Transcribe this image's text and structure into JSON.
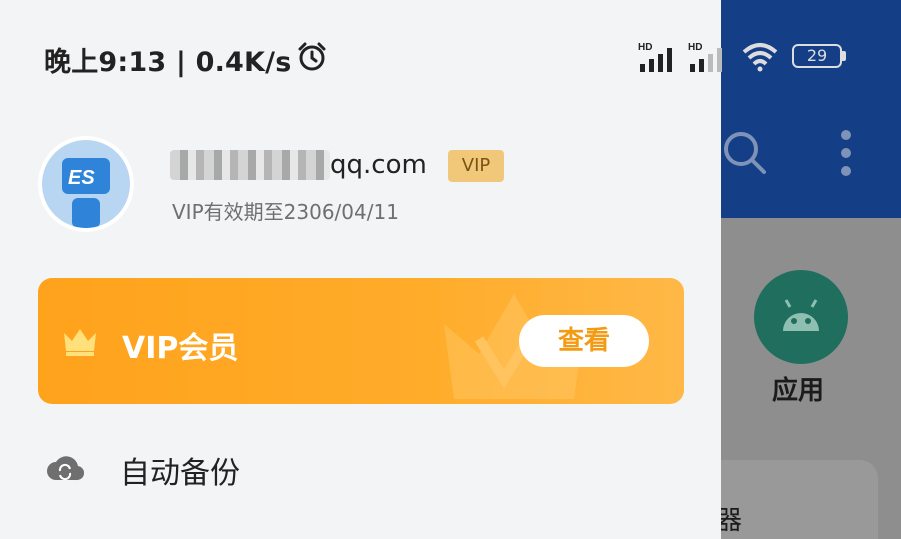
{
  "status_bar": {
    "time": "晚上9:13 | 0.4K/s",
    "battery": "29",
    "hd_label": "HD"
  },
  "profile": {
    "email": "qq.com",
    "vip_badge": "VIP",
    "vip_expire": "VIP有效期至2306/04/11"
  },
  "vip_banner": {
    "title": "VIP会员",
    "button": "查看"
  },
  "menu": {
    "items": [
      {
        "label": "自动备份",
        "icon": "cloud-sync-icon"
      }
    ]
  },
  "background_app": {
    "app_label": "应用",
    "partial_text": "器"
  },
  "colors": {
    "accent": "#ffa21c",
    "vip_badge": "#f1c87a",
    "header": "#143f87"
  }
}
